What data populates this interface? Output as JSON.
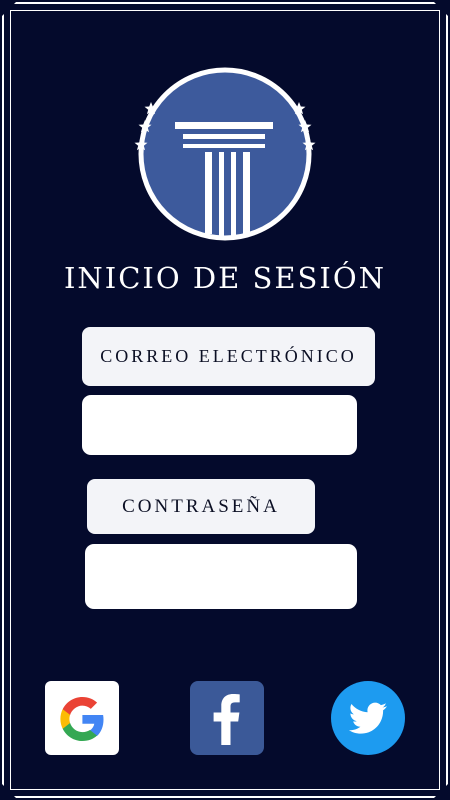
{
  "header": {
    "title": "INICIO DE SESIÓN",
    "logo_icon": "pillar-emblem-icon"
  },
  "form": {
    "email_label": "CORREO ELECTRÓNICO",
    "email_value": "",
    "password_label": "CONTRASEÑA",
    "password_value": ""
  },
  "social_login": [
    {
      "name": "Google",
      "icon": "google-icon",
      "color": "#ffffff"
    },
    {
      "name": "Facebook",
      "icon": "facebook-icon",
      "color": "#3b5998"
    },
    {
      "name": "Twitter",
      "icon": "twitter-icon",
      "color": "#1d9bf0"
    }
  ],
  "colors": {
    "background": "#040a2c",
    "logo_circle": "#3d5a9c",
    "frame": "#ffffff"
  }
}
